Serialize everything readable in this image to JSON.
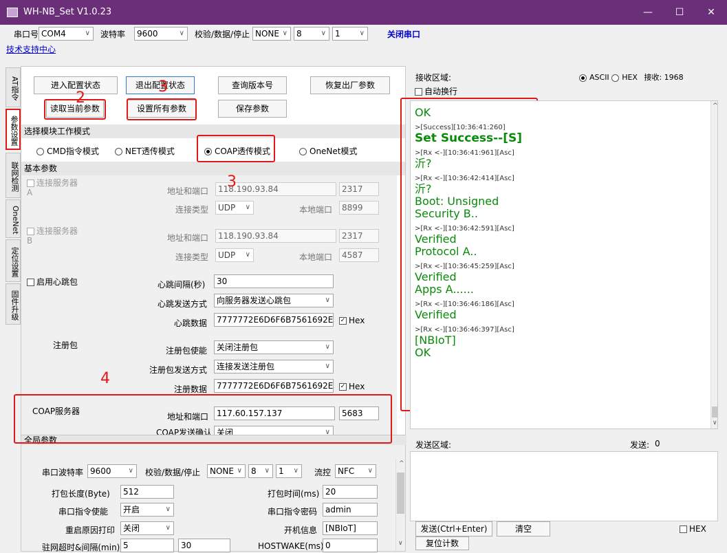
{
  "window": {
    "title": "WH-NB_Set V1.0.23",
    "min": "—",
    "max": "☐",
    "close": "✕"
  },
  "toolbar": {
    "port_label": "串口号",
    "port_value": "COM4",
    "baud_label": "波特率",
    "baud_value": "9600",
    "parity_label": "校验/数据/停止",
    "parity_value": "NONE",
    "data_value": "8",
    "stop_value": "1",
    "close_port": "关闭串口",
    "support_link": "技术支持中心"
  },
  "tabs": [
    "AT指令",
    "参数设置",
    "联网检测",
    "OneNet",
    "定位设置",
    "固件升级"
  ],
  "buttons": {
    "enter_config": "进入配置状态",
    "exit_config": "退出配置状态",
    "query_version": "查询版本号",
    "restore": "恢复出厂参数",
    "read_params": "读取当前参数",
    "set_all": "设置所有参数",
    "save_params": "保存参数"
  },
  "mode": {
    "header": "选择模块工作模式",
    "options": [
      "CMD指令模式",
      "NET透传模式",
      "COAP透传模式",
      "OneNet模式"
    ]
  },
  "basic": {
    "header": "基本参数",
    "serverA": {
      "label": "连接服务器A",
      "addr_label": "地址和端口",
      "addr": "118.190.93.84",
      "port": "2317",
      "type_label": "连接类型",
      "type": "UDP",
      "local_label": "本地端口",
      "local": "8899"
    },
    "serverB": {
      "label": "连接服务器B",
      "addr_label": "地址和端口",
      "addr": "118.190.93.84",
      "port": "2317",
      "type_label": "连接类型",
      "type": "UDP",
      "local_label": "本地端口",
      "local": "4587"
    },
    "heartbeat": {
      "label": "启用心跳包",
      "interval_label": "心跳间隔(秒)",
      "interval": "30",
      "mode_label": "心跳发送方式",
      "mode": "向服务器发送心跳包",
      "data_label": "心跳数据",
      "data": "7777772E6D6F6B7561692E636",
      "hex": "Hex"
    },
    "register": {
      "label": "注册包",
      "enable_label": "注册包使能",
      "enable": "关闭注册包",
      "mode_label": "注册包发送方式",
      "mode": "连接发送注册包",
      "data_label": "注册数据",
      "data": "7777772E6D6F6B7561692E636",
      "hex": "Hex"
    },
    "coap": {
      "label": "COAP服务器",
      "addr_label": "地址和端口",
      "addr": "117.60.157.137",
      "port": "5683",
      "confirm_label": "COAP发送确认",
      "confirm": "关闭"
    }
  },
  "global": {
    "header": "全局参数",
    "baud_label": "串口波特率",
    "baud": "9600",
    "parity_label": "校验/数据/停止",
    "parity": "NONE",
    "data": "8",
    "stop": "1",
    "flow_label": "流控",
    "flow": "NFC",
    "pack_len_label": "打包长度(Byte)",
    "pack_len": "512",
    "pack_time_label": "打包时间(ms)",
    "pack_time": "20",
    "cmd_enable_label": "串口指令使能",
    "cmd_enable": "开启",
    "cmd_pwd_label": "串口指令密码",
    "cmd_pwd": "admin",
    "reboot_label": "重启原因打印",
    "reboot": "关闭",
    "boot_label": "开机信息",
    "boot": "[NBIoT]",
    "timeout_label": "驻网超时&间隔(min)",
    "timeout1": "5",
    "timeout2": "30",
    "hostwake_label": "HOSTWAKE(ms)",
    "hostwake": "0"
  },
  "annotations": [
    "2",
    "3",
    "3",
    "4"
  ],
  "receive": {
    "label": "接收区域:",
    "autowrap": "自动换行",
    "ascii": "ASCII",
    "hex": "HEX",
    "count_label": "接收:",
    "count": "1968"
  },
  "log": [
    {
      "k": "g",
      "t": "OK"
    },
    {
      "k": "s",
      "t": ">[Success][10:36:41:260]"
    },
    {
      "k": "b",
      "t": "Set Success--[S]"
    },
    {
      "k": "s",
      "t": ">[Rx <-][10:36:41:961][Asc]"
    },
    {
      "k": "g",
      "t": "沂?"
    },
    {
      "k": "s",
      "t": ">[Rx <-][10:36:42:414][Asc]"
    },
    {
      "k": "g",
      "t": "沂?"
    },
    {
      "k": "g",
      "t": "Boot: Unsigned"
    },
    {
      "k": "g",
      "t": "Security B.."
    },
    {
      "k": "s",
      "t": ">[Rx <-][10:36:42:591][Asc]"
    },
    {
      "k": "g",
      "t": "Verified"
    },
    {
      "k": "g",
      "t": "Protocol A.."
    },
    {
      "k": "s",
      "t": ">[Rx <-][10:36:45:259][Asc]"
    },
    {
      "k": "g",
      "t": "Verified"
    },
    {
      "k": "g",
      "t": "Apps A......"
    },
    {
      "k": "s",
      "t": ">[Rx <-][10:36:46:186][Asc]"
    },
    {
      "k": "g",
      "t": "Verified"
    },
    {
      "k": "s",
      "t": ">[Rx <-][10:36:46:397][Asc]"
    },
    {
      "k": "g",
      "t": "[NBIoT]"
    },
    {
      "k": "g",
      "t": "OK"
    }
  ],
  "send": {
    "label": "发送区域:",
    "count_label": "发送:",
    "count": "0",
    "send_btn": "发送(Ctrl+Enter)",
    "clear_btn": "清空",
    "hex": "HEX",
    "reset_btn": "复位计数"
  }
}
